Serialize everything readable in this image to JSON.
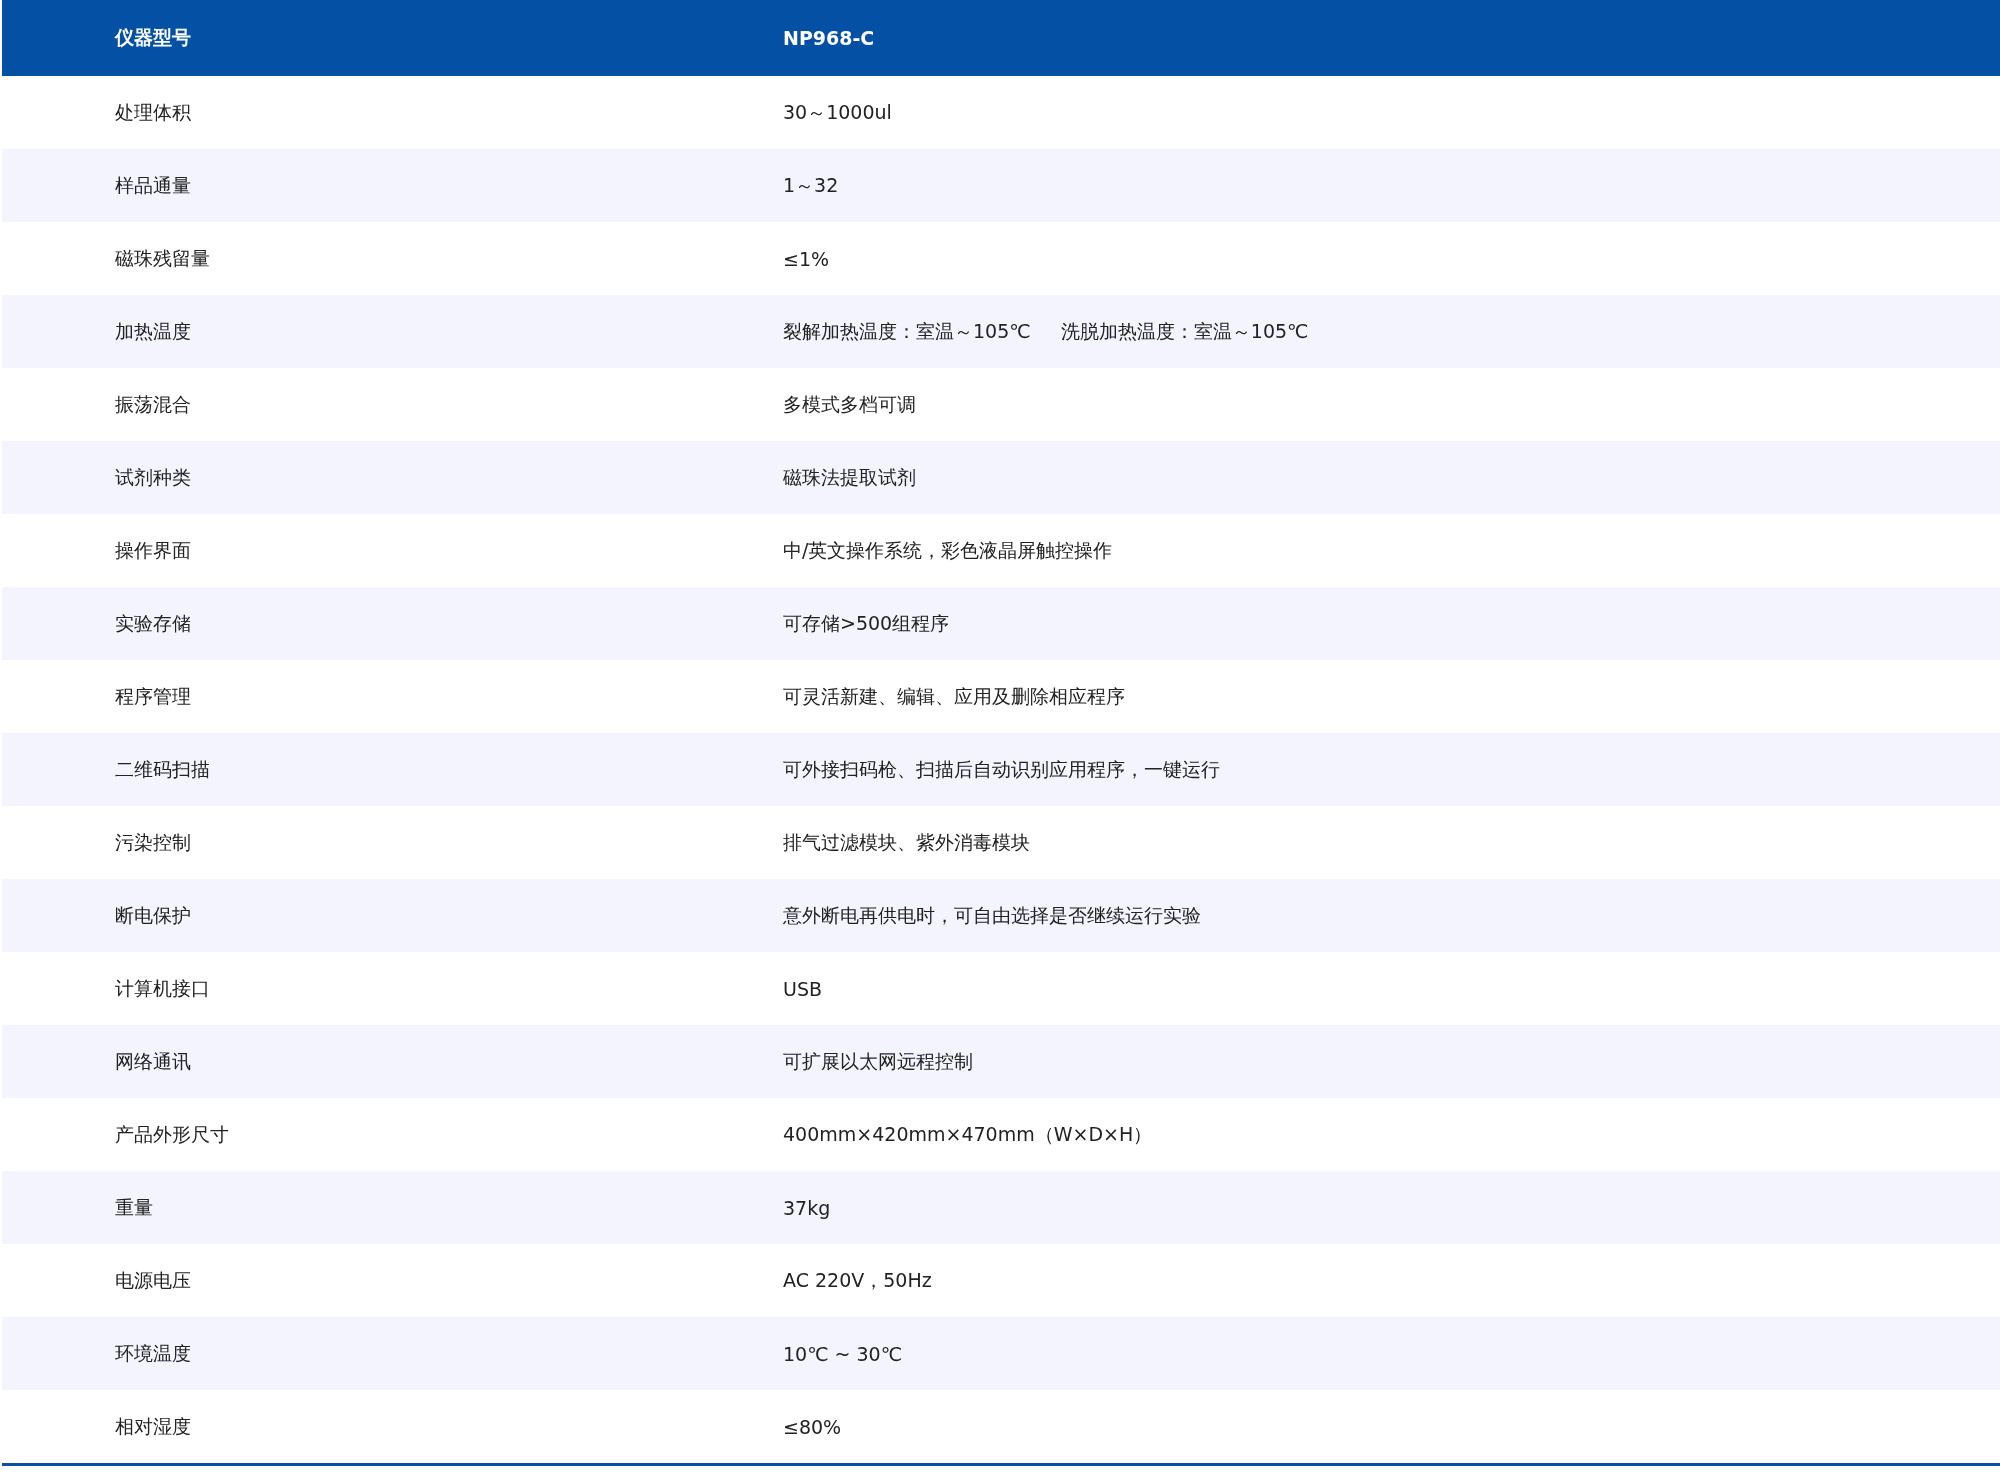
{
  "table": {
    "header": [
      "仪器型号",
      "NP968-C"
    ],
    "rows": [
      [
        "处理体积",
        "30～1000ul"
      ],
      [
        "样品通量",
        "1～32"
      ],
      [
        "磁珠残留量",
        "≤1%"
      ],
      [
        "加热温度",
        "裂解加热温度：室温～105℃     洗脱加热温度：室温～105℃"
      ],
      [
        "振荡混合",
        "多模式多档可调"
      ],
      [
        "试剂种类",
        "磁珠法提取试剂"
      ],
      [
        "操作界面",
        "中/英文操作系统，彩色液晶屏触控操作"
      ],
      [
        "实验存储",
        "可存储>500组程序"
      ],
      [
        "程序管理",
        "可灵活新建、编辑、应用及删除相应程序"
      ],
      [
        "二维码扫描",
        "可外接扫码枪、扫描后自动识别应用程序，一键运行"
      ],
      [
        "污染控制",
        "排气过滤模块、紫外消毒模块"
      ],
      [
        "断电保护",
        "意外断电再供电时，可自由选择是否继续运行实验"
      ],
      [
        "计算机接口",
        "USB"
      ],
      [
        "网络通讯",
        "可扩展以太网远程控制"
      ],
      [
        "产品外形尺寸",
        "400mm×420mm×470mm（W×D×H）"
      ],
      [
        "重量",
        "37kg"
      ],
      [
        "电源电压",
        "AC 220V，50Hz"
      ],
      [
        "环境温度",
        "10℃ ~ 30℃"
      ],
      [
        "相对湿度",
        "≤80%"
      ]
    ]
  }
}
